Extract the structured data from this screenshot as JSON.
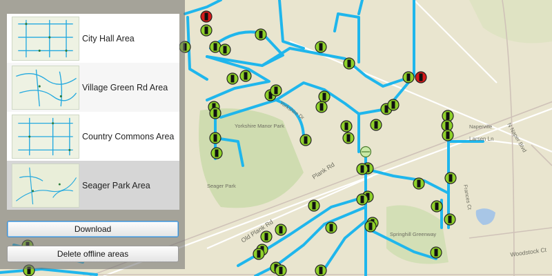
{
  "offline_areas": [
    {
      "name": "City Hall Area",
      "selected": false
    },
    {
      "name": "Village Green Rd Area",
      "selected": false
    },
    {
      "name": "Country Commons Area",
      "selected": false
    },
    {
      "name": "Seager Park Area",
      "selected": true
    }
  ],
  "buttons": {
    "download": "Download",
    "delete": "Delete offline areas"
  },
  "map": {
    "roads": [
      {
        "label": "Plank Rd"
      },
      {
        "label": "Old Plank Rd"
      },
      {
        "label": "N Naper Blvd"
      },
      {
        "label": "Larsen Ln"
      },
      {
        "label": "Frances Ct"
      },
      {
        "label": "Woodstock Ct"
      },
      {
        "label": "Yorkshire Dr"
      }
    ],
    "places": [
      {
        "label": "Yorkshire Manor Park"
      },
      {
        "label": "Seager Park"
      },
      {
        "label": "Naperville"
      },
      {
        "label": "Springhill Greenway"
      }
    ],
    "colors": {
      "pipeline": "#1fb6ec",
      "hydrant_ok": "#8fd12a",
      "hydrant_alert": "#d71a1a",
      "background": "#e9e5cf",
      "park": "#cfdcb0"
    }
  }
}
